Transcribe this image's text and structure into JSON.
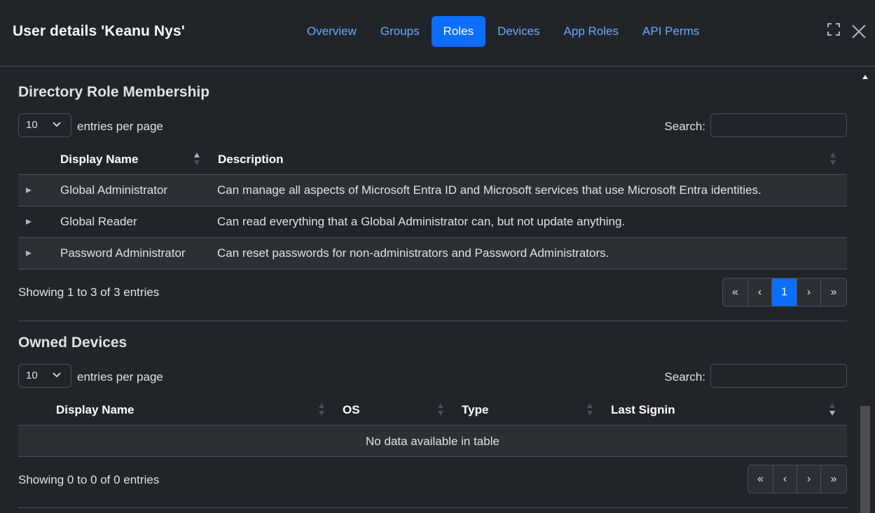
{
  "header": {
    "title": "User details 'Keanu Nys'",
    "tabs": [
      {
        "label": "Overview",
        "active": false
      },
      {
        "label": "Groups",
        "active": false
      },
      {
        "label": "Roles",
        "active": true
      },
      {
        "label": "Devices",
        "active": false
      },
      {
        "label": "App Roles",
        "active": false
      },
      {
        "label": "API Perms",
        "active": false
      }
    ],
    "icons": [
      "expand-icon",
      "close-icon"
    ]
  },
  "roles": {
    "title": "Directory Role Membership",
    "page_size": "10",
    "entries_label": "entries per page",
    "search_label": "Search:",
    "search_value": "",
    "columns": [
      "Display Name",
      "Description"
    ],
    "rows": [
      {
        "name": "Global Administrator",
        "description": "Can manage all aspects of Microsoft Entra ID and Microsoft services that use Microsoft Entra identities."
      },
      {
        "name": "Global Reader",
        "description": "Can read everything that a Global Administrator can, but not update anything."
      },
      {
        "name": "Password Administrator",
        "description": "Can reset passwords for non-administrators and Password Administrators."
      }
    ],
    "info": "Showing 1 to 3 of 3 entries",
    "pager": {
      "first": "«",
      "prev": "‹",
      "current": "1",
      "next": "›",
      "last": "»"
    }
  },
  "devices": {
    "title": "Owned Devices",
    "page_size": "10",
    "entries_label": "entries per page",
    "search_label": "Search:",
    "search_value": "",
    "columns": [
      "Display Name",
      "OS",
      "Type",
      "Last Signin"
    ],
    "empty_text": "No data available in table",
    "info": "Showing 0 to 0 of 0 entries",
    "pager": {
      "first": "«",
      "prev": "‹",
      "next": "›",
      "last": "»"
    }
  },
  "colors": {
    "background": "#212529",
    "accent": "#0d6efd",
    "link": "#6ea8fe",
    "border": "#495057",
    "stripe": "#2c3034"
  }
}
